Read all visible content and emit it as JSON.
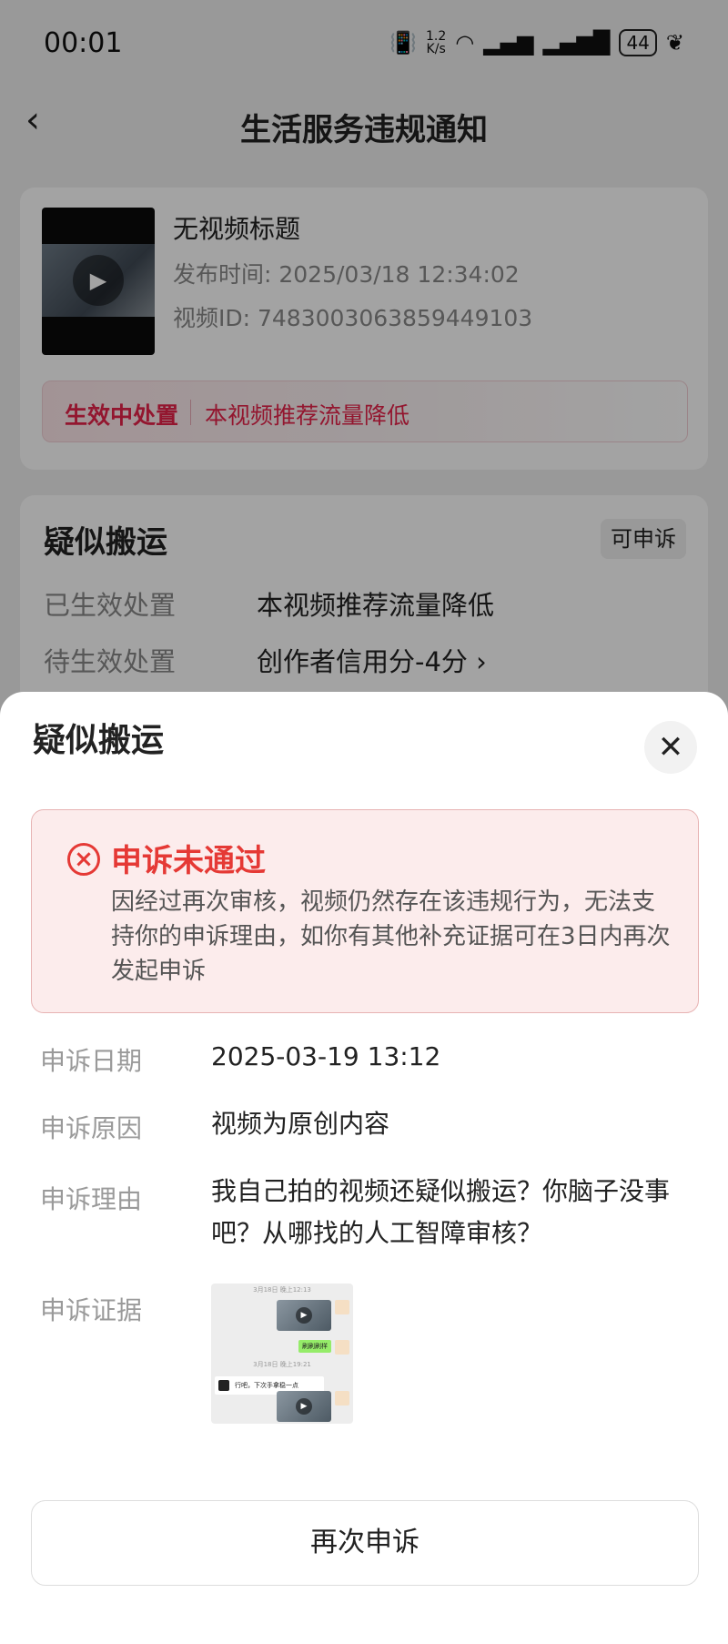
{
  "status_bar": {
    "time": "00:01",
    "net_speed_value": "1.2",
    "net_speed_unit": "K/s",
    "battery": "44"
  },
  "nav": {
    "title": "生活服务违规通知"
  },
  "video_card": {
    "title": "无视频标题",
    "publish_time": "发布时间: 2025/03/18 12:34:02",
    "video_id": "视频ID: 7483003063859449103",
    "penalty_tag": "生效中处置",
    "penalty_text": "本视频推荐流量降低"
  },
  "violation_card": {
    "title": "疑似搬运",
    "badge": "可申诉",
    "rows": [
      {
        "label": "已生效处置",
        "value": "本视频推荐流量降低"
      },
      {
        "label": "待生效处置",
        "value": "创作者信用分-4分"
      }
    ]
  },
  "sheet": {
    "title": "疑似搬运",
    "result": {
      "title": "申诉未通过",
      "desc": "因经过再次审核，视频仍然存在该违规行为，无法支持你的申诉理由，如你有其他补充证据可在3日内再次发起申诉"
    },
    "details": [
      {
        "label": "申诉日期",
        "value": "2025-03-19 13:12"
      },
      {
        "label": "申诉原因",
        "value": "视频为原创内容"
      },
      {
        "label": "申诉理由",
        "value": "我自己拍的视频还疑似搬运？你脑子没事吧？从哪找的人工智障审核？"
      },
      {
        "label": "申诉证据",
        "value": ""
      }
    ],
    "evidence": {
      "time1": "3月18日 晚上12:13",
      "green_msg": "刷刷刷样",
      "time2": "3月18日 晚上19:21",
      "reply": "行吧，下次手拿稳一点"
    },
    "reappeal_label": "再次申诉"
  }
}
